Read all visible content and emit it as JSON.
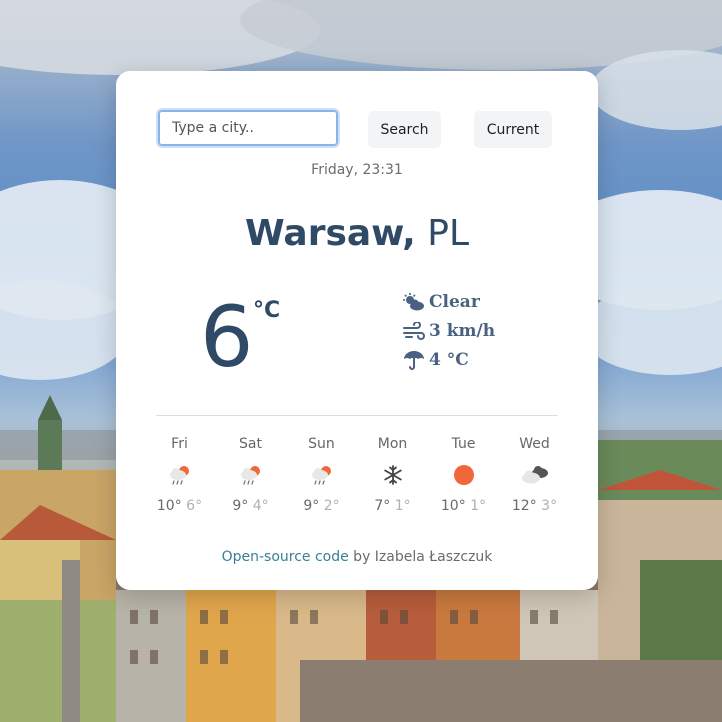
{
  "search": {
    "placeholder": "Type a city..",
    "search_label": "Search",
    "current_label": "Current"
  },
  "date_time": "Friday, 23:31",
  "location": {
    "city": "Warsaw,",
    "country": "PL"
  },
  "current": {
    "temperature": "6",
    "unit": "°C",
    "description": "Clear",
    "wind": "3 km/h",
    "precipitation": "4 °C",
    "icons": [
      "partly-cloudy-icon",
      "wind-icon",
      "umbrella-icon"
    ]
  },
  "forecast": [
    {
      "day": "Fri",
      "max": "10°",
      "min": "6°",
      "icon": "rain-sun-icon"
    },
    {
      "day": "Sat",
      "max": "9°",
      "min": "4°",
      "icon": "rain-sun-icon"
    },
    {
      "day": "Sun",
      "max": "9°",
      "min": "2°",
      "icon": "rain-sun-icon"
    },
    {
      "day": "Mon",
      "max": "7°",
      "min": "1°",
      "icon": "snowflake-icon"
    },
    {
      "day": "Tue",
      "max": "10°",
      "min": "1°",
      "icon": "sun-icon"
    },
    {
      "day": "Wed",
      "max": "12°",
      "min": "3°",
      "icon": "clouds-icon"
    }
  ],
  "footer": {
    "link_text": "Open-source code",
    "author_text": " by Izabela Łaszczuk"
  },
  "colors": {
    "accent": "#2f4a66",
    "link": "#3a7f94",
    "sun": "#f2673a"
  }
}
